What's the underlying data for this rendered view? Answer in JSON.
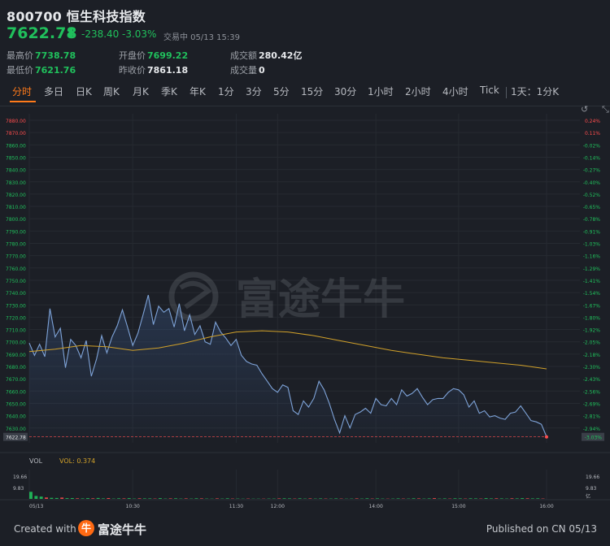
{
  "header": {
    "title": "800700 恒生科技指数",
    "price": "7622.78",
    "arrow_icon": "down-arrow",
    "change": "-238.40",
    "change_pct": "-3.03%",
    "status": "交易中 05/13 15:39"
  },
  "stats": [
    {
      "label": "最高价",
      "value": "7738.78",
      "color": "green"
    },
    {
      "label": "开盘价",
      "value": "7699.22",
      "color": "green"
    },
    {
      "label": "成交额",
      "value": "280.42亿",
      "color": "white"
    },
    {
      "label": "最低价",
      "value": "7621.76",
      "color": "green"
    },
    {
      "label": "昨收价",
      "value": "7861.18",
      "color": "white"
    },
    {
      "label": "成交量",
      "value": "0",
      "color": "white"
    }
  ],
  "tabs": [
    "分时",
    "多日",
    "日K",
    "周K",
    "月K",
    "季K",
    "年K",
    "1分",
    "3分",
    "5分",
    "15分",
    "30分",
    "1小时",
    "2小时",
    "4小时",
    "Tick",
    "1天：1分K"
  ],
  "active_tab": "分时",
  "watermark": "富途牛牛",
  "volume_bar": {
    "vol_label": "VOL",
    "vol_value": "VOL: 0.374"
  },
  "colors": {
    "green": "#20c05c",
    "red": "#ff4d4d",
    "orange": "#ff7a1a",
    "line": "#7ea3d8",
    "avg": "#d1a12a"
  },
  "footer": {
    "created_with": "Created with",
    "brand": "富途牛牛",
    "published": "Published on CN 05/13"
  },
  "chart_data": {
    "type": "line",
    "title": "",
    "y_ticks": [
      "7880.00",
      "7870.00",
      "7860.00",
      "7850.00",
      "7840.00",
      "7830.00",
      "7820.00",
      "7810.00",
      "7800.00",
      "7790.00",
      "7780.00",
      "7770.00",
      "7760.00",
      "7750.00",
      "7740.00",
      "7730.00",
      "7720.00",
      "7710.00",
      "7700.00",
      "7690.00",
      "7680.00",
      "7670.00",
      "7660.00",
      "7650.00",
      "7640.00",
      "7630.00"
    ],
    "pct_ticks": [
      "0.24%",
      "0.11%",
      "-0.02%",
      "-0.14%",
      "-0.27%",
      "-0.40%",
      "-0.52%",
      "-0.65%",
      "-0.78%",
      "-0.91%",
      "-1.03%",
      "-1.16%",
      "-1.29%",
      "-1.41%",
      "-1.54%",
      "-1.67%",
      "-1.80%",
      "-1.92%",
      "-2.05%",
      "-2.18%",
      "-2.30%",
      "-2.43%",
      "-2.56%",
      "-2.69%",
      "-2.81%",
      "-2.94%"
    ],
    "current_label": "7622.78",
    "current_pct": "-3.03%",
    "x_ticks": [
      "05/13",
      "10:30",
      "11:30",
      "12:00",
      "14:00",
      "15:00",
      "16:00"
    ],
    "x_tick_frac": [
      0.0,
      0.2,
      0.4,
      0.48,
      0.67,
      0.83,
      1.0
    ],
    "ylim": [
      7622,
      7880
    ],
    "series": [
      {
        "name": "",
        "x_frac": [
          0.0,
          0.01,
          0.02,
          0.03,
          0.04,
          0.05,
          0.06,
          0.07,
          0.08,
          0.09,
          0.1,
          0.11,
          0.12,
          0.13,
          0.14,
          0.15,
          0.16,
          0.17,
          0.18,
          0.19,
          0.2,
          0.21,
          0.22,
          0.23,
          0.24,
          0.25,
          0.26,
          0.27,
          0.28,
          0.29,
          0.3,
          0.31,
          0.32,
          0.33,
          0.34,
          0.35,
          0.36,
          0.37,
          0.38,
          0.39,
          0.4,
          0.41,
          0.42,
          0.43,
          0.44,
          0.45,
          0.46,
          0.47,
          0.48,
          0.49,
          0.5,
          0.51,
          0.52,
          0.53,
          0.54,
          0.55,
          0.56,
          0.57,
          0.58,
          0.59,
          0.6,
          0.61,
          0.62,
          0.63,
          0.64,
          0.65,
          0.66,
          0.67,
          0.68,
          0.69,
          0.7,
          0.71,
          0.72,
          0.73,
          0.74,
          0.75,
          0.76,
          0.77,
          0.78,
          0.79,
          0.8,
          0.81,
          0.82,
          0.83,
          0.84,
          0.85,
          0.86,
          0.87,
          0.88,
          0.89,
          0.9,
          0.91,
          0.92,
          0.93,
          0.94,
          0.95,
          0.96,
          0.97,
          0.98,
          0.99,
          1.0
        ],
        "values": [
          7699,
          7689,
          7698,
          7688,
          7727,
          7704,
          7711,
          7679,
          7702,
          7697,
          7687,
          7701,
          7672,
          7686,
          7705,
          7691,
          7704,
          7713,
          7726,
          7712,
          7697,
          7707,
          7722,
          7738,
          7714,
          7729,
          7724,
          7727,
          7712,
          7731,
          7709,
          7722,
          7706,
          7713,
          7700,
          7698,
          7716,
          7708,
          7703,
          7697,
          7702,
          7689,
          7684,
          7682,
          7681,
          7674,
          7668,
          7662,
          7659,
          7665,
          7663,
          7644,
          7641,
          7652,
          7647,
          7654,
          7668,
          7661,
          7650,
          7637,
          7626,
          7640,
          7630,
          7641,
          7643,
          7646,
          7642,
          7654,
          7649,
          7648,
          7654,
          7649,
          7661,
          7656,
          7658,
          7662,
          7655,
          7649,
          7653,
          7654,
          7654,
          7659,
          7662,
          7661,
          7657,
          7647,
          7652,
          7642,
          7644,
          7639,
          7640,
          7638,
          7637,
          7642,
          7643,
          7648,
          7642,
          7636,
          7635,
          7633,
          7623
        ]
      },
      {
        "name": "",
        "x_frac": [
          0.0,
          0.05,
          0.1,
          0.15,
          0.2,
          0.25,
          0.3,
          0.35,
          0.4,
          0.45,
          0.5,
          0.55,
          0.6,
          0.65,
          0.7,
          0.75,
          0.8,
          0.85,
          0.9,
          0.95,
          1.0
        ],
        "values": [
          7692,
          7694,
          7697,
          7696,
          7693,
          7695,
          7699,
          7704,
          7708,
          7709,
          7708,
          7705,
          7701,
          7697,
          7693,
          7690,
          7687,
          7685,
          7683,
          7681,
          7678
        ]
      }
    ],
    "volume": {
      "ylim": [
        0,
        19.66
      ],
      "y_ticks": [
        "19.66",
        "9.83"
      ],
      "unit": "亿",
      "values": [
        6.1,
        2.5,
        2.0,
        1.2,
        0.9,
        0.8,
        1.1,
        0.6,
        0.7,
        0.5,
        0.4,
        0.6,
        0.5,
        0.8,
        0.4,
        0.7,
        0.3,
        0.5,
        0.4,
        0.6,
        0.3,
        0.5,
        0.4,
        0.4,
        0.3,
        0.6,
        0.3,
        0.4,
        0.5,
        0.3,
        0.4,
        0.3,
        0.5,
        0.4,
        0.3,
        0.2,
        0.4,
        0.3,
        0.5,
        0.3,
        0.3,
        0.2,
        0.3,
        0.2,
        0.2,
        0.2,
        0.3,
        0.3,
        0.4,
        0.5,
        0.4,
        0.3,
        0.5,
        0.3,
        0.4,
        0.3,
        0.4,
        0.3,
        0.3,
        0.4,
        0.3,
        0.2,
        0.3,
        0.4,
        0.3,
        0.5,
        0.3,
        0.4,
        0.3,
        0.2,
        0.3,
        0.4,
        0.3,
        0.3,
        0.5,
        0.4,
        0.3,
        0.4,
        0.6,
        0.3,
        0.4,
        0.3,
        0.5,
        0.4,
        0.3,
        0.5,
        0.4,
        0.3,
        0.6,
        0.4,
        0.5,
        0.4,
        0.3,
        0.5,
        0.4,
        0.6,
        0.5,
        0.4,
        0.5,
        0.3
      ]
    }
  }
}
